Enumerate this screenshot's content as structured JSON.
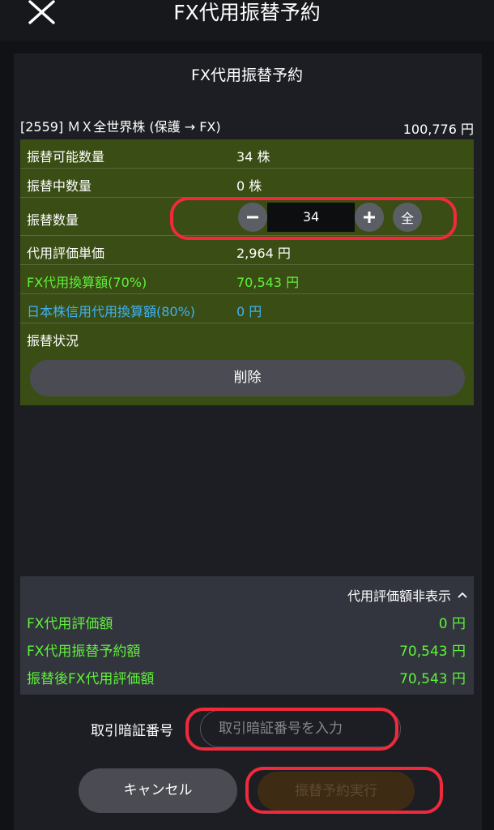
{
  "header": {
    "title": "FX代用振替予約",
    "close_icon": "close-icon"
  },
  "panel": {
    "title": "FX代用振替予約"
  },
  "security": {
    "name": "[2559] ＭＸ全世界株 (保護 → FX)",
    "price": "100,776 円"
  },
  "details": {
    "transferable_label": "振替可能数量",
    "transferable_value": "34 株",
    "in_transfer_label": "振替中数量",
    "in_transfer_value": "0 株",
    "transfer_qty_label": "振替数量",
    "transfer_qty_value": "34",
    "all_label": "全",
    "unit_price_label": "代用評価単価",
    "unit_price_value": "2,964 円",
    "fx_conversion_label": "FX代用換算額(70%)",
    "fx_conversion_value": "70,543 円",
    "jp_margin_label": "日本株信用代用換算額(80%)",
    "jp_margin_value": "0 円",
    "status_label": "振替状況",
    "delete_label": "削除"
  },
  "summary": {
    "toggle_label": "代用評価額非表示",
    "rows": [
      {
        "label": "FX代用評価額",
        "value": "0 円"
      },
      {
        "label": "FX代用振替予約額",
        "value": "70,543 円"
      },
      {
        "label": "振替後FX代用評価額",
        "value": "70,543 円"
      }
    ]
  },
  "pin": {
    "label": "取引暗証番号",
    "placeholder": "取引暗証番号を入力",
    "value": ""
  },
  "actions": {
    "cancel_label": "キャンセル",
    "submit_label": "振替予約実行"
  },
  "colors": {
    "accent_green": "#5ff23a",
    "accent_blue": "#3fb1f3",
    "highlight_red": "#f02a3c",
    "row_bg": "#3a4d14"
  }
}
